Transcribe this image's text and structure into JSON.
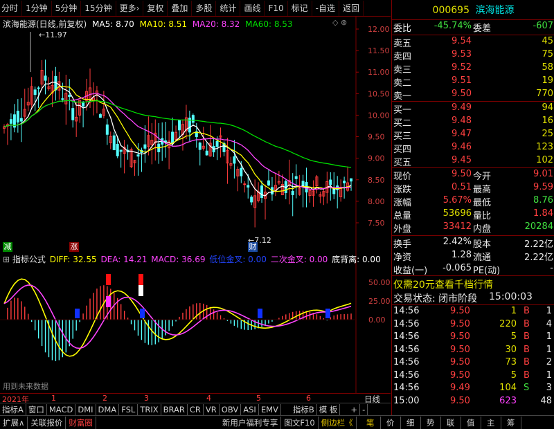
{
  "toolbar": {
    "items": [
      "分时",
      "1分钟",
      "5分钟",
      "15分钟",
      "更多›",
      "复权",
      "叠加",
      "多股",
      "统计",
      "画线",
      "F10",
      "标记",
      "-自选",
      "返回"
    ]
  },
  "kline": {
    "title": "滨海能源(日线,前复权)",
    "ma5_label": "MA5: 8.70",
    "ma10_label": "MA10: 8.51",
    "ma20_label": "MA20: 8.32",
    "ma60_label": "MA60: 8.53",
    "high_marker": "11.97",
    "low_marker": "7.12",
    "yaxis": [
      "12.00",
      "11.50",
      "11.00",
      "10.50",
      "10.00",
      "9.50",
      "9.00",
      "8.50",
      "8.00",
      "7.50"
    ],
    "tag_jian": "减",
    "tag_zhang": "涨",
    "tag_cai": "财",
    "colors": {
      "up": "#ff3c3c",
      "down": "#54ffff",
      "ma5": "#ffffff",
      "ma10": "#ffff00",
      "ma20": "#ff44ff",
      "ma60": "#00dd00"
    }
  },
  "indicator": {
    "name": "指标公式",
    "diff": "DIFF: 32.55",
    "dea": "DEA: 14.21",
    "macd": "MACD: 36.69",
    "low_cross": "低位金叉: 0.00",
    "second_cross": "二次金叉: 0.00",
    "bottom_div": "底背离: 0.00",
    "yaxis": [
      "50.00",
      "25.00",
      "0.00"
    ],
    "footnote": "用到未来数据"
  },
  "timeaxis": {
    "year": "2021年",
    "months": [
      "1",
      "2",
      "3",
      "4",
      "5",
      "6"
    ],
    "daily": "日线"
  },
  "tabs": [
    "指标A",
    "窗口",
    "MACD",
    "DMI",
    "DMA",
    "FSL",
    "TRIX",
    "BRAR",
    "CR",
    "VR",
    "OBV",
    "ASI",
    "EMV",
    "指标B",
    "模 板",
    "+",
    "-"
  ],
  "bottom": [
    "扩展∧",
    "关联报价",
    "财富圈",
    "新用户福利专享",
    "图文F10",
    "侧边栏《",
    "笔",
    "价",
    "细",
    "势",
    "联",
    "值",
    "主",
    "筹"
  ],
  "quote": {
    "code": "000695",
    "name": "滨海能源",
    "weibi_label": "委比",
    "weibi": "-45.74%",
    "weicha_label": "委差",
    "weicha": "-607",
    "asks": [
      {
        "label": "卖五",
        "price": "9.54",
        "vol": "45"
      },
      {
        "label": "卖四",
        "price": "9.53",
        "vol": "75"
      },
      {
        "label": "卖三",
        "price": "9.52",
        "vol": "58"
      },
      {
        "label": "卖二",
        "price": "9.51",
        "vol": "19"
      },
      {
        "label": "卖一",
        "price": "9.50",
        "vol": "770"
      }
    ],
    "bids": [
      {
        "label": "买一",
        "price": "9.49",
        "vol": "94"
      },
      {
        "label": "买二",
        "price": "9.48",
        "vol": "16"
      },
      {
        "label": "买三",
        "price": "9.47",
        "vol": "25"
      },
      {
        "label": "买四",
        "price": "9.46",
        "vol": "123"
      },
      {
        "label": "买五",
        "price": "9.45",
        "vol": "102"
      }
    ],
    "stats": [
      [
        "现价",
        "9.50",
        "今开",
        "9.01",
        "r",
        "r"
      ],
      [
        "涨跌",
        "0.51",
        "最高",
        "9.59",
        "r",
        "r"
      ],
      [
        "涨幅",
        "5.67%",
        "最低",
        "8.76",
        "r",
        "g"
      ],
      [
        "总量",
        "53696",
        "量比",
        "1.84",
        "y",
        "r"
      ],
      [
        "外盘",
        "33412",
        "内盘",
        "20284",
        "r",
        "g"
      ]
    ],
    "stats2": [
      [
        "换手",
        "2.42%",
        "股本",
        "2.22亿"
      ],
      [
        "净资",
        "1.28",
        "流通",
        "2.22亿"
      ],
      [
        "收益(一)",
        "-0.065",
        "PE(动)",
        "-"
      ]
    ],
    "promo": "仅需20元查看千档行情",
    "status_label": "交易状态: 闭市阶段",
    "status_time": "15:00:03",
    "ticks": [
      {
        "t": "14:56",
        "p": "9.50",
        "v": "1",
        "s": "B",
        "n": "1",
        "vc": "y",
        "sc": "r"
      },
      {
        "t": "14:56",
        "p": "9.50",
        "v": "220",
        "s": "B",
        "n": "4",
        "vc": "y",
        "sc": "r"
      },
      {
        "t": "14:56",
        "p": "9.50",
        "v": "5",
        "s": "B",
        "n": "1",
        "vc": "y",
        "sc": "r"
      },
      {
        "t": "14:56",
        "p": "9.50",
        "v": "30",
        "s": "B",
        "n": "1",
        "vc": "y",
        "sc": "r"
      },
      {
        "t": "14:56",
        "p": "9.50",
        "v": "73",
        "s": "B",
        "n": "2",
        "vc": "y",
        "sc": "r"
      },
      {
        "t": "14:56",
        "p": "9.50",
        "v": "5",
        "s": "B",
        "n": "1",
        "vc": "y",
        "sc": "r"
      },
      {
        "t": "14:56",
        "p": "9.49",
        "v": "104",
        "s": "S",
        "n": "3",
        "vc": "y",
        "sc": "g"
      },
      {
        "t": "15:00",
        "p": "9.50",
        "v": "623",
        "s": "",
        "n": "48",
        "vc": "m",
        "sc": "r"
      }
    ]
  }
}
